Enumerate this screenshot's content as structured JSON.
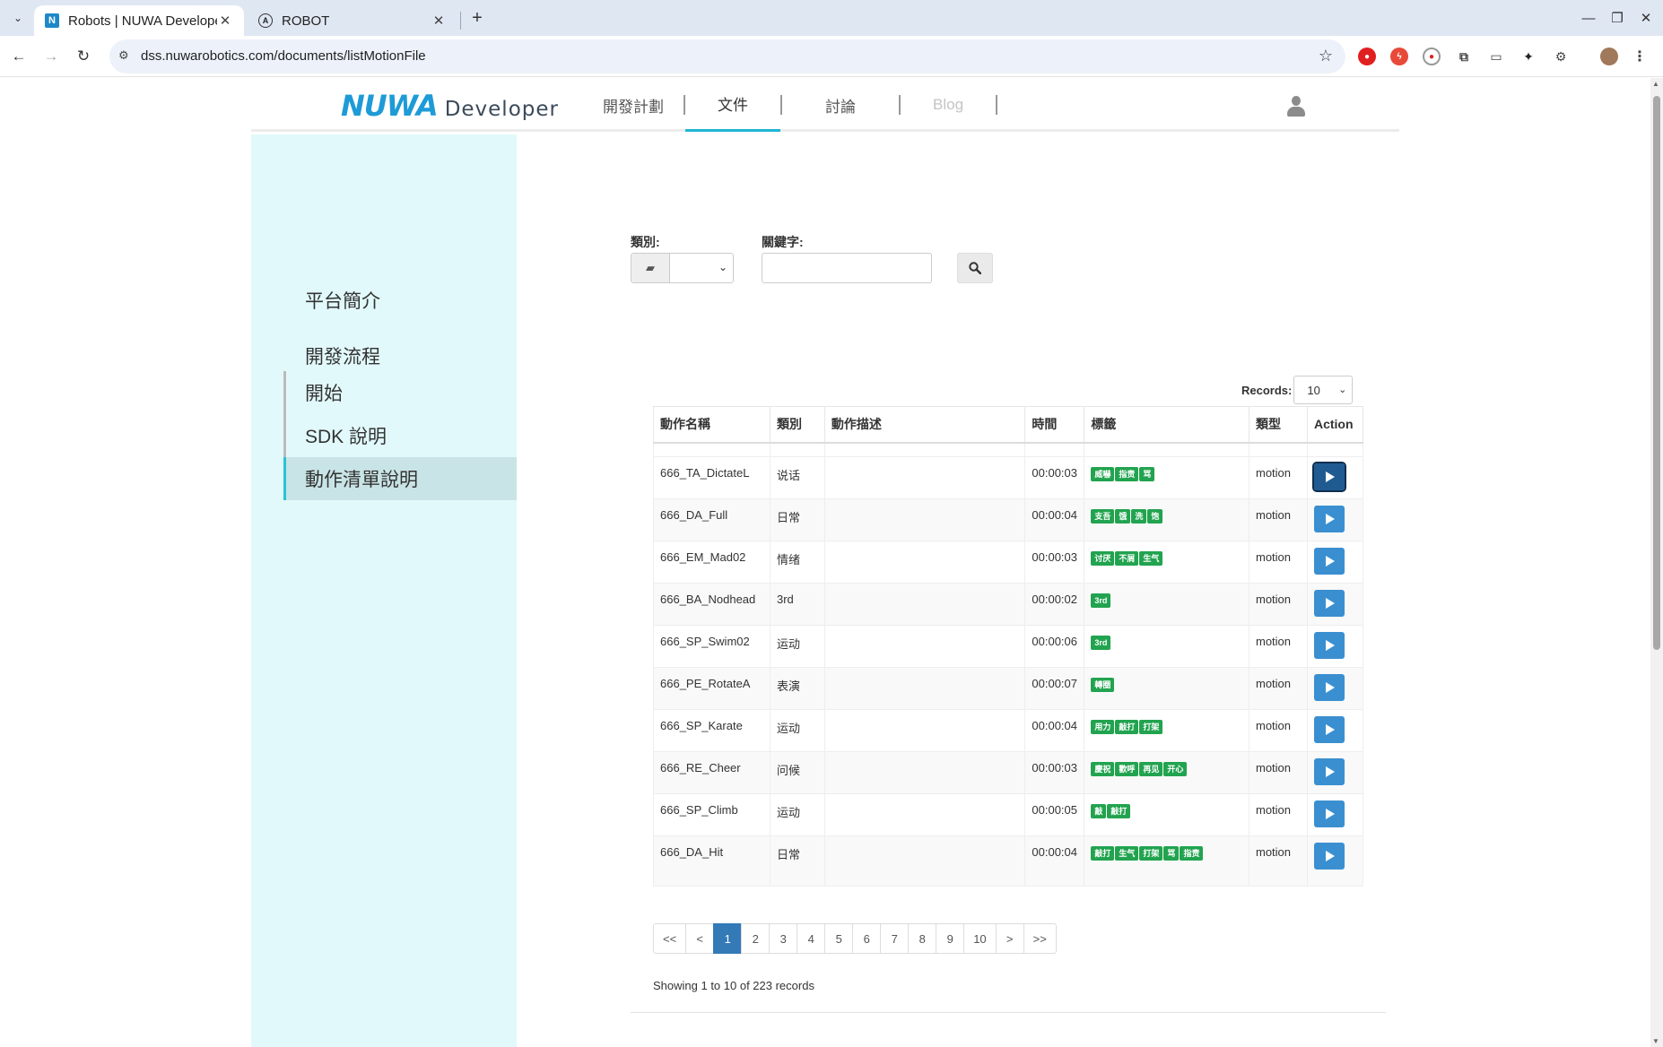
{
  "browser": {
    "tabs": [
      {
        "title": "Robots | NUWA Developer",
        "favicon": "N",
        "active": true
      },
      {
        "title": "ROBOT",
        "favicon": "A",
        "active": false
      }
    ],
    "url": "dss.nuwarobotics.com/documents/listMotionFile",
    "extensions": [
      {
        "name": "adblock-icon",
        "color": "#e02020",
        "glyph": "●"
      },
      {
        "name": "flash-icon",
        "color": "#e84a3a",
        "glyph": "ϟ"
      },
      {
        "name": "record-icon",
        "color": "#ffffff",
        "glyph": "◉"
      },
      {
        "name": "copy-icon",
        "color": "#ffffff",
        "glyph": "⧉"
      },
      {
        "name": "screen-icon",
        "color": "#ffffff",
        "glyph": "▭"
      },
      {
        "name": "bird-icon",
        "color": "#ffffff",
        "glyph": "✦"
      },
      {
        "name": "puzzle-icon",
        "color": "#ffffff",
        "glyph": "⚙"
      }
    ]
  },
  "header": {
    "logo_brand": "NUWA",
    "logo_sub": "Developer",
    "nav": [
      {
        "label": "開發計劃",
        "state": "normal"
      },
      {
        "label": "文件",
        "state": "active"
      },
      {
        "label": "討論",
        "state": "normal"
      },
      {
        "label": "Blog",
        "state": "disabled"
      }
    ]
  },
  "sidebar": {
    "items": [
      "平台簡介",
      "開發流程"
    ],
    "subitems": [
      {
        "label": "開始",
        "active": false
      },
      {
        "label": "SDK 說明",
        "active": false
      },
      {
        "label": "動作清單說明",
        "active": true
      }
    ]
  },
  "filters": {
    "category_label": "類別:",
    "keyword_label": "關鍵字:",
    "keyword_value": ""
  },
  "records": {
    "label": "Records:",
    "value": "10"
  },
  "table": {
    "headers": [
      "動作名稱",
      "類別",
      "動作描述",
      "時間",
      "標籤",
      "類型",
      "Action"
    ],
    "rows": [
      {
        "name": "666_TA_DictateL",
        "category": "说话",
        "desc": "",
        "time": "00:00:03",
        "tags": [
          "威嚇",
          "指责",
          "骂"
        ],
        "type": "motion"
      },
      {
        "name": "666_DA_Full",
        "category": "日常",
        "desc": "",
        "time": "00:00:04",
        "tags": [
          "支吾",
          "饿",
          "洗",
          "饱"
        ],
        "type": "motion"
      },
      {
        "name": "666_EM_Mad02",
        "category": "情绪",
        "desc": "",
        "time": "00:00:03",
        "tags": [
          "讨厌",
          "不屑",
          "生气"
        ],
        "type": "motion"
      },
      {
        "name": "666_BA_Nodhead",
        "category": "3rd",
        "desc": "",
        "time": "00:00:02",
        "tags": [
          "3rd"
        ],
        "type": "motion"
      },
      {
        "name": "666_SP_Swim02",
        "category": "运动",
        "desc": "",
        "time": "00:00:06",
        "tags": [
          "3rd"
        ],
        "type": "motion"
      },
      {
        "name": "666_PE_RotateA",
        "category": "表演",
        "desc": "",
        "time": "00:00:07",
        "tags": [
          "轉圈"
        ],
        "type": "motion"
      },
      {
        "name": "666_SP_Karate",
        "category": "运动",
        "desc": "",
        "time": "00:00:04",
        "tags": [
          "用力",
          "敲打",
          "打架"
        ],
        "type": "motion"
      },
      {
        "name": "666_RE_Cheer",
        "category": "问候",
        "desc": "",
        "time": "00:00:03",
        "tags": [
          "慶祝",
          "歡呼",
          "再见",
          "开心"
        ],
        "type": "motion"
      },
      {
        "name": "666_SP_Climb",
        "category": "运动",
        "desc": "",
        "time": "00:00:05",
        "tags": [
          "敲",
          "敲打"
        ],
        "type": "motion"
      },
      {
        "name": "666_DA_Hit",
        "category": "日常",
        "desc": "",
        "time": "00:00:04",
        "tags": [
          "敲打",
          "生气",
          "打架",
          "骂",
          "指责"
        ],
        "type": "motion"
      }
    ]
  },
  "pagination": {
    "items": [
      "<<",
      "<",
      "1",
      "2",
      "3",
      "4",
      "5",
      "6",
      "7",
      "8",
      "9",
      "10",
      ">",
      ">>"
    ],
    "active": "1",
    "summary": "Showing 1 to 10 of 223 records"
  },
  "colors": {
    "accent": "#1fb5d4",
    "tag": "#22a34f",
    "button": "#3a8fd0",
    "sidebar_bg": "#e2f9fb"
  }
}
